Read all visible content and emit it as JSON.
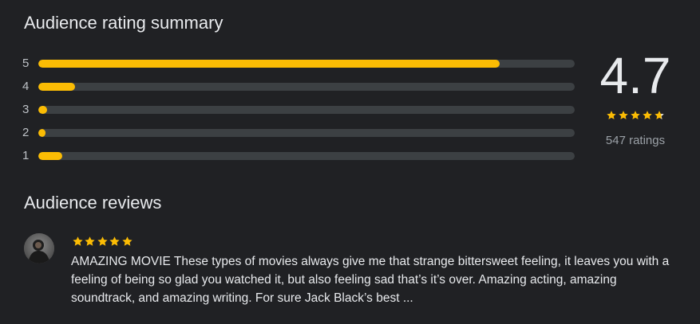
{
  "summary": {
    "title": "Audience rating summary",
    "score": "4.7",
    "score_stars": 4.7,
    "count_label": "547 ratings",
    "bars": [
      {
        "label": "5",
        "fraction": 0.86
      },
      {
        "label": "4",
        "fraction": 0.068
      },
      {
        "label": "3",
        "fraction": 0.016
      },
      {
        "label": "2",
        "fraction": 0.014
      },
      {
        "label": "1",
        "fraction": 0.044
      }
    ]
  },
  "reviews": {
    "title": "Audience reviews",
    "items": [
      {
        "stars": 5,
        "text": "AMAZING MOVIE These types of movies always give me that strange bittersweet feeling, it leaves you with a feeling of being so glad you watched it, but also feeling sad that’s it’s over. Amazing acting, amazing soundtrack, and amazing writing. For sure Jack Black’s best ..."
      }
    ]
  },
  "colors": {
    "background": "#202124",
    "accent": "#fbbc04",
    "track": "#3c4043",
    "text": "#e8eaed",
    "muted": "#9aa0a6"
  },
  "icons": {
    "star": "star-icon",
    "avatar": "user-avatar"
  }
}
